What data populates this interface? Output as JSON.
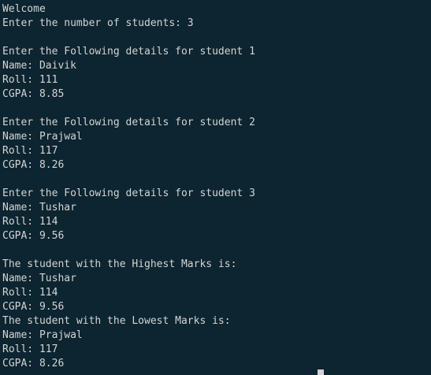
{
  "terminal": {
    "welcome": "Welcome",
    "prompt_students": "Enter the number of students: 3",
    "students": [
      {
        "header": "Enter the Following details for student 1",
        "name": "Name: Daivik",
        "roll": "Roll: 111",
        "cgpa": "CGPA: 8.85"
      },
      {
        "header": "Enter the Following details for student 2",
        "name": "Name: Prajwal",
        "roll": "Roll: 117",
        "cgpa": "CGPA: 8.26"
      },
      {
        "header": "Enter the Following details for student 3",
        "name": "Name: Tushar",
        "roll": "Roll: 114",
        "cgpa": "CGPA: 9.56"
      }
    ],
    "highest": {
      "header": "The student with the Highest Marks is:",
      "name": "Name: Tushar",
      "roll": "Roll: 114",
      "cgpa": "CGPA: 9.56"
    },
    "lowest": {
      "header": "The student with the Lowest Marks is:",
      "name": "Name: Prajwal",
      "roll": "Roll: 117",
      "cgpa": "CGPA: 8.26"
    }
  },
  "colors": {
    "background": "#0c2530",
    "text": "#d4d4d4"
  }
}
